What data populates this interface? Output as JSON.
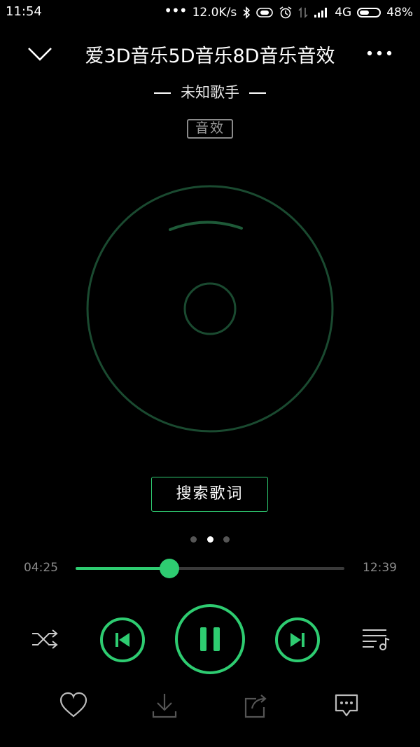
{
  "status": {
    "time": "11:54",
    "dots": "•••",
    "speed": "12.0K/s",
    "network": "4G",
    "battery_percent": "48%",
    "battery_level": 0.48
  },
  "header": {
    "title": "爱3D音乐5D音乐8D音乐音效",
    "artist": "未知歌手",
    "badge": "音效"
  },
  "lyrics": {
    "search_label": "搜索歌词"
  },
  "pager": {
    "count": 3,
    "active": 1
  },
  "progress": {
    "current": "04:25",
    "total": "12:39",
    "fraction": 0.35
  },
  "colors": {
    "accent": "#2ecc71",
    "background": "#000000"
  }
}
